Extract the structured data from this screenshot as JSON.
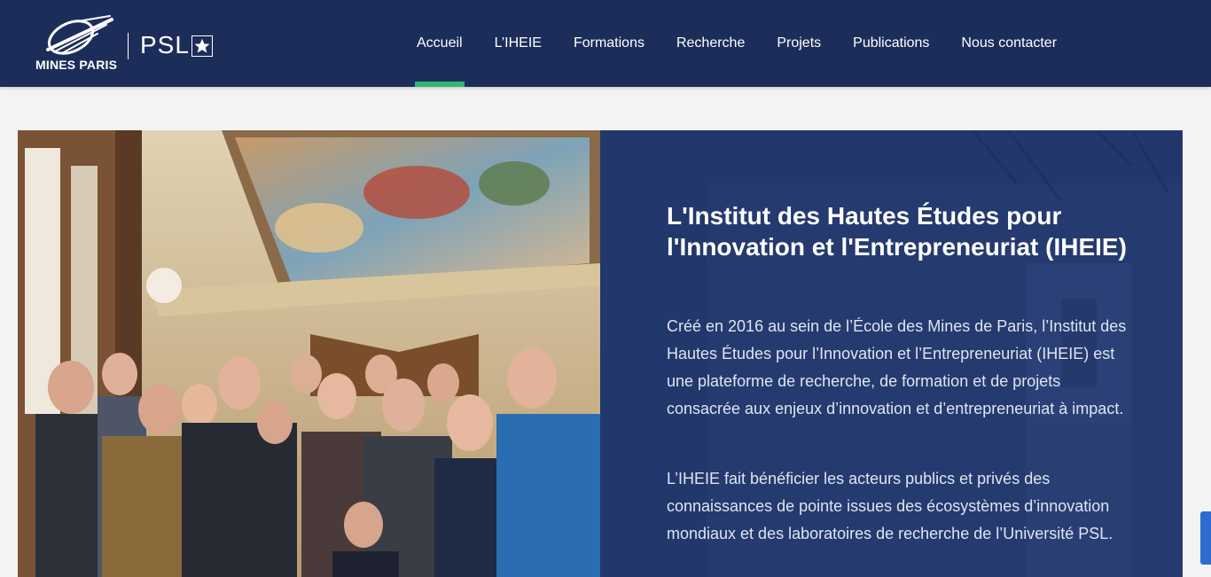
{
  "brand": {
    "school": "MINES PARIS",
    "university": "PSL"
  },
  "nav": {
    "items": [
      {
        "label": "Accueil",
        "active": true
      },
      {
        "label": "L’IHEIE",
        "active": false
      },
      {
        "label": "Formations",
        "active": false
      },
      {
        "label": "Recherche",
        "active": false
      },
      {
        "label": "Projets",
        "active": false
      },
      {
        "label": "Publications",
        "active": false
      },
      {
        "label": "Nous contacter",
        "active": false
      }
    ]
  },
  "hero": {
    "title": "L'Institut des Hautes Études pour l'Innovation et l'Entrepreneuriat (IHEIE)",
    "paragraph1": "Créé en 2016 au sein de l’École des Mines de Paris, l’Institut des Hautes Études pour l’Innovation et l’Entrepreneuriat (IHEIE) est une plateforme de recherche, de formation et de projets consacrée aux enjeux d’innovation et d’entrepreneuriat à impact.",
    "paragraph2": "L’IHEIE fait bénéficier les acteurs publics et privés des connaissances de pointe issues des écosystèmes d’innovation mondiaux et des laboratoires de recherche de l’Université PSL."
  },
  "colors": {
    "header_bg": "#1d2d5a",
    "active_indicator": "#2eb872",
    "panel_bg": "#24396e",
    "page_bg": "#f3f3f3"
  }
}
